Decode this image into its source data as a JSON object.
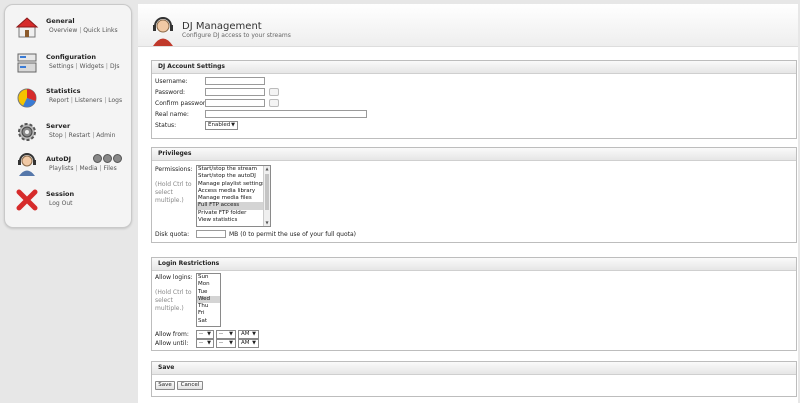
{
  "sidebar": {
    "general": {
      "title": "General",
      "links": [
        "Overview",
        "Quick Links"
      ]
    },
    "configuration": {
      "title": "Configuration",
      "links": [
        "Settings",
        "Widgets",
        "DJs"
      ]
    },
    "statistics": {
      "title": "Statistics",
      "links": [
        "Report",
        "Listeners",
        "Logs"
      ]
    },
    "server": {
      "title": "Server",
      "links": [
        "Stop",
        "Restart",
        "Admin"
      ]
    },
    "autodj": {
      "title": "AutoDJ",
      "links": [
        "Playlists",
        "Media",
        "Files"
      ]
    },
    "session": {
      "title": "Session",
      "links": [
        "Log Out"
      ]
    }
  },
  "header": {
    "title": "DJ Management",
    "subtitle": "Configure DJ access to your streams"
  },
  "account": {
    "heading": "DJ Account Settings",
    "username_label": "Username:",
    "password_label": "Password:",
    "confirm_label": "Confirm password:",
    "realname_label": "Real name:",
    "status_label": "Status:",
    "status_value": "Enabled"
  },
  "privileges": {
    "heading": "Privileges",
    "permissions_label": "Permissions:",
    "hint": "(Hold Ctrl to select multiple.)",
    "options": [
      "Start/stop the stream",
      "Start/stop the autoDJ",
      "Manage playlist settings",
      "Access media library",
      "Manage media files",
      "Full FTP access",
      "Private FTP folder",
      "View statistics"
    ],
    "selected_index": 5,
    "disk_quota_label": "Disk quota:",
    "disk_quota_note": "MB (0 to permit the use of your full quota)"
  },
  "login": {
    "heading": "Login Restrictions",
    "allow_logins_label": "Allow logins:",
    "hint": "(Hold Ctrl to select multiple.)",
    "days": [
      "Sun",
      "Mon",
      "Tue",
      "Wed",
      "Thu",
      "Fri",
      "Sat"
    ],
    "selected_day_index": 3,
    "allow_from_label": "Allow from:",
    "allow_until_label": "Allow until:",
    "hour_value": "--",
    "minute_value": "--",
    "ampm_value": "AM"
  },
  "save": {
    "heading": "Save",
    "save_label": "Save",
    "cancel_label": "Cancel"
  },
  "colors": {
    "accent_red": "#c0392b",
    "panel_border": "#bdbdbd"
  }
}
